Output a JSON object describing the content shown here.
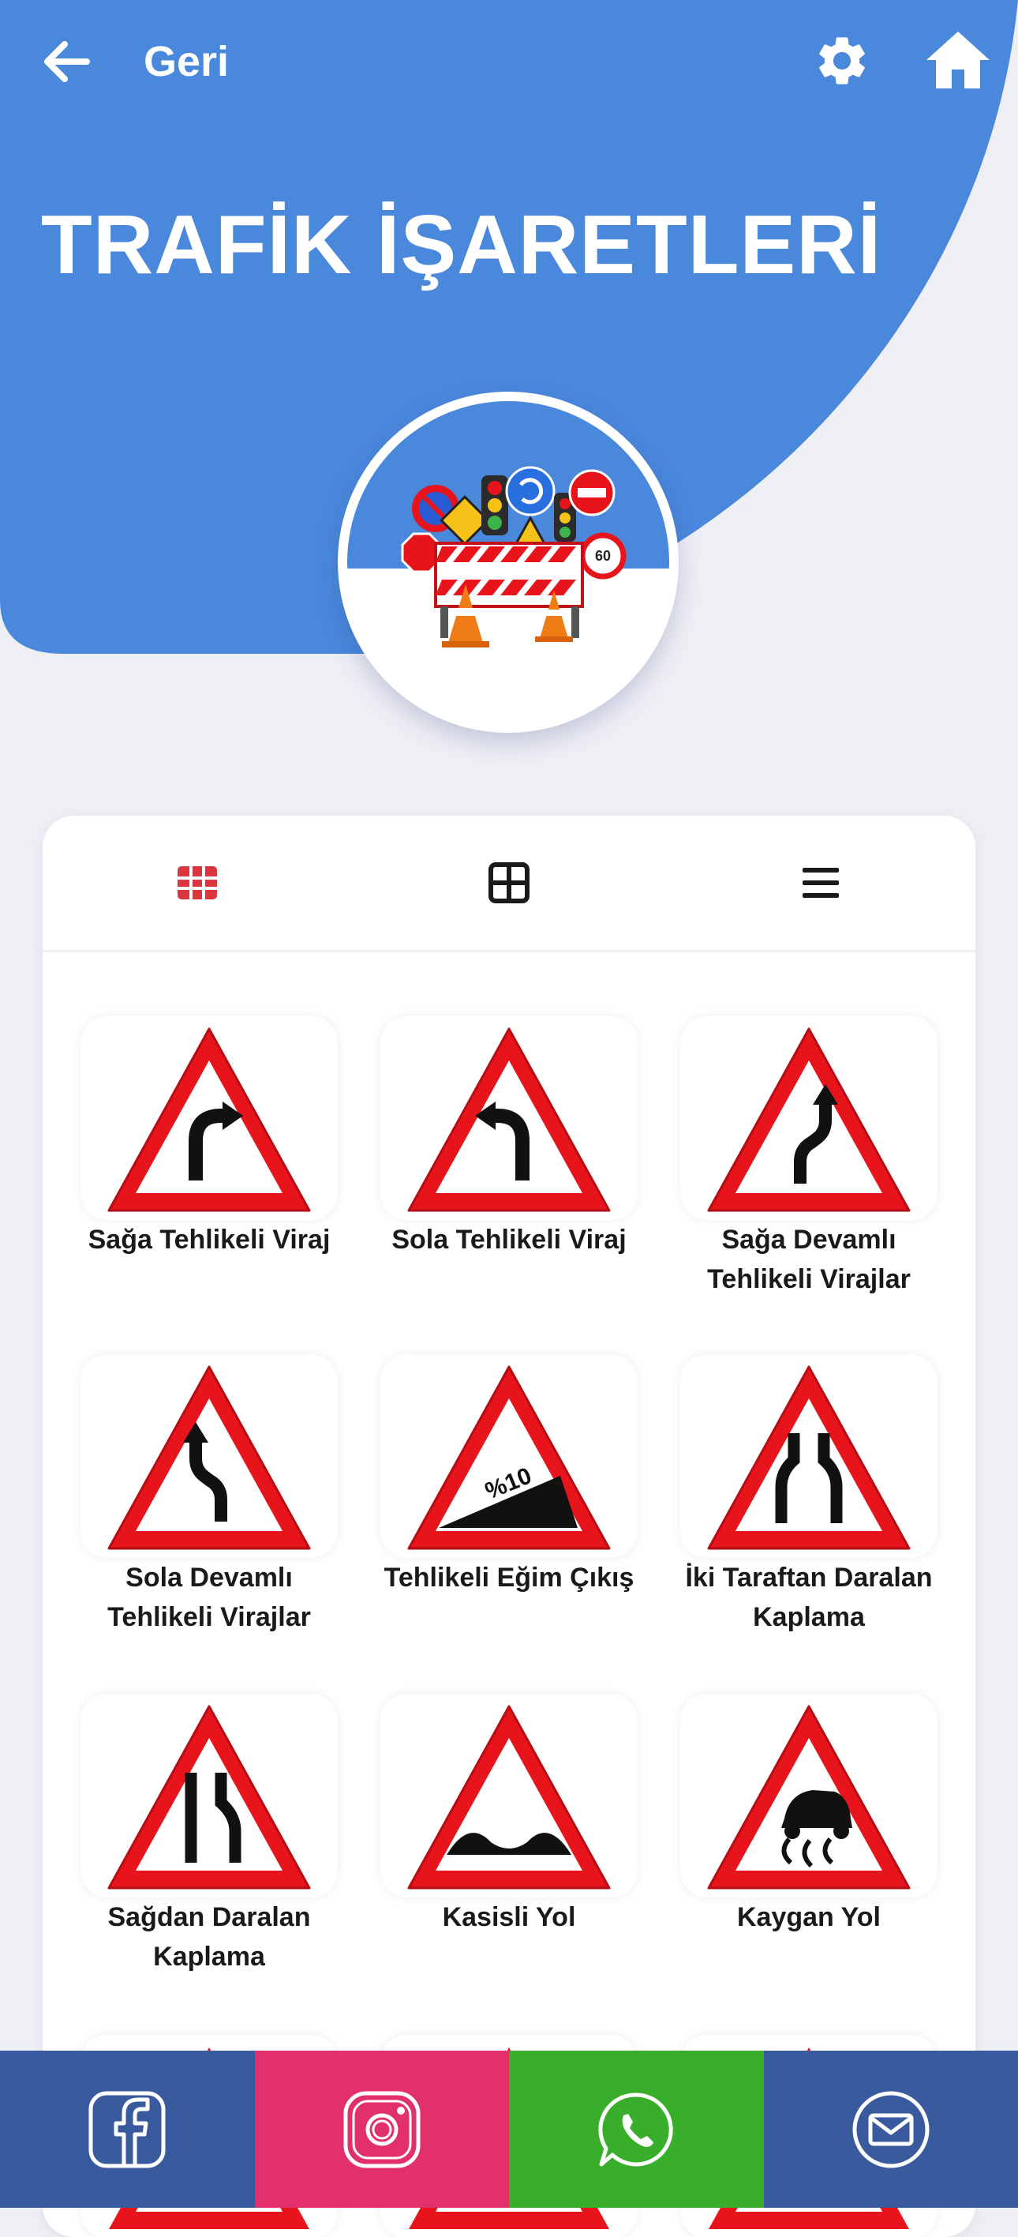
{
  "colors": {
    "hero": "#4a88dc",
    "background": "#eeeef5",
    "active_tab": "#d9363e",
    "tab_icon": "#1a1a1a",
    "sign_red": "#e8141c",
    "facebook": "#3a5a9e",
    "instagram": "#e2306c",
    "whatsapp": "#39ae2a",
    "email": "#3a5a9e"
  },
  "topbar": {
    "back_icon": "arrow-left-icon",
    "back_label": "Geri",
    "settings_icon": "gear-icon",
    "home_icon": "home-icon"
  },
  "header": {
    "title": "TRAFİK İŞARETLERİ",
    "hero_image": "traffic-signs-barrier-illustration"
  },
  "view_tabs": [
    {
      "icon": "grid-3x3-icon",
      "active": true
    },
    {
      "icon": "grid-2x2-icon",
      "active": false
    },
    {
      "icon": "list-icon",
      "active": false
    }
  ],
  "signs": [
    {
      "label": "Sağa Tehlikeli Viraj",
      "icon": "right-curve-sign-icon"
    },
    {
      "label": "Sola Tehlikeli Viraj",
      "icon": "left-curve-sign-icon"
    },
    {
      "label": "Sağa Devamlı Tehlikeli Virajlar",
      "icon": "double-curve-right-sign-icon"
    },
    {
      "label": "Sola Devamlı Tehlikeli Virajlar",
      "icon": "double-curve-left-sign-icon"
    },
    {
      "label": "Tehlikeli Eğim Çıkış",
      "icon": "steep-ascent-sign-icon",
      "sign_text": "%10"
    },
    {
      "label": "İki Taraftan Daralan Kaplama",
      "icon": "road-narrows-both-sides-sign-icon"
    },
    {
      "label": "Sağdan Daralan Kaplama",
      "icon": "road-narrows-right-sign-icon"
    },
    {
      "label": "Kasisli Yol",
      "icon": "uneven-road-sign-icon"
    },
    {
      "label": "Kaygan Yol",
      "icon": "slippery-road-sign-icon"
    }
  ],
  "share_bar": [
    {
      "name": "facebook",
      "icon": "facebook-icon"
    },
    {
      "name": "instagram",
      "icon": "instagram-icon"
    },
    {
      "name": "whatsapp",
      "icon": "whatsapp-icon"
    },
    {
      "name": "email",
      "icon": "mail-icon"
    }
  ]
}
